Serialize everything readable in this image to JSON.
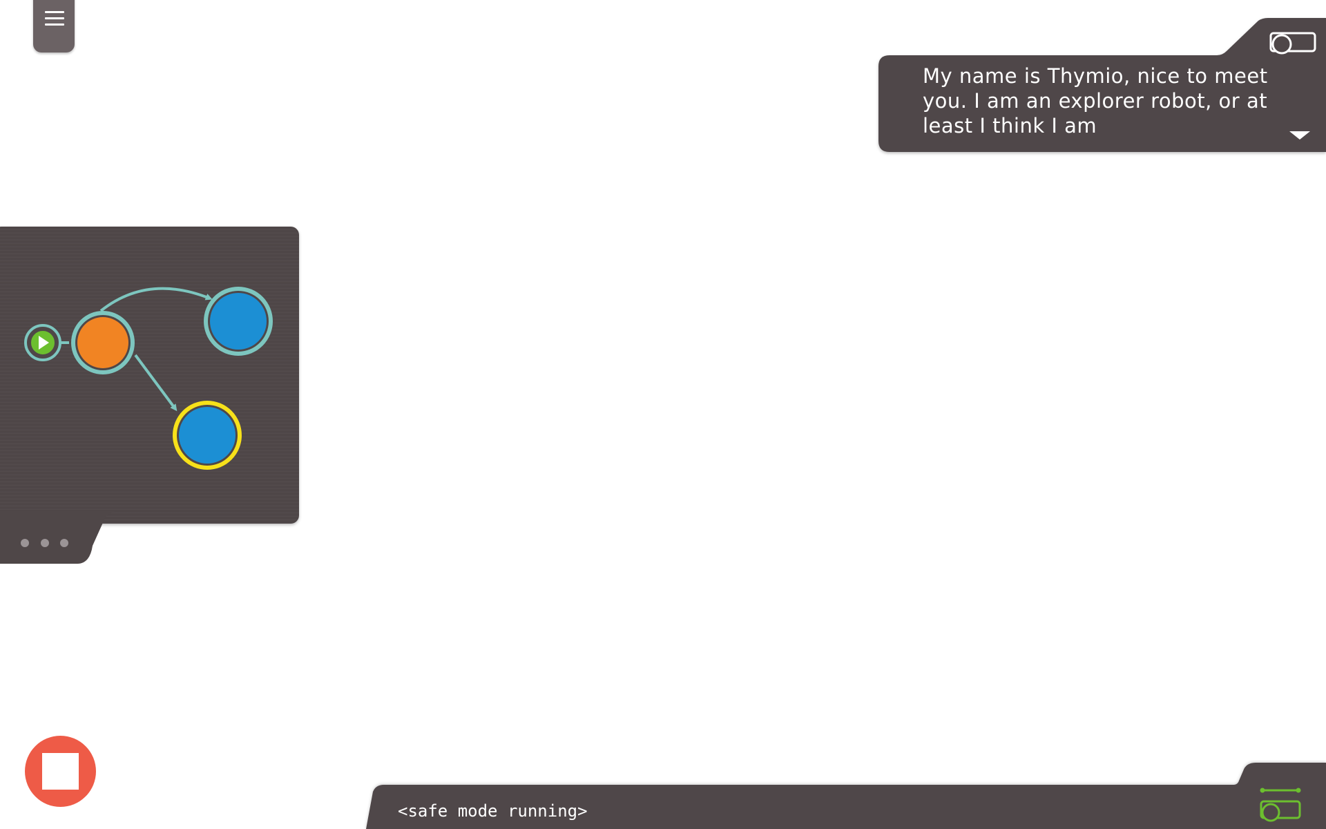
{
  "app": {
    "speech_text": "My name is Thymio, nice to meet you. I am an explorer robot, or at least I think I am",
    "status_text": "<safe mode running>"
  },
  "icons": {
    "menu": "hamburger-menu-icon",
    "camera": "camera-toggle-icon",
    "expand": "caret-down-icon",
    "stop": "stop-icon",
    "play": "play-icon",
    "more": "ellipsis-icon",
    "fullscreen": "camera-toggle-icon"
  },
  "program": {
    "states": [
      {
        "id": "start",
        "color": "#6cbf2f",
        "role": "start"
      },
      {
        "id": "state-orange",
        "color": "#f18423",
        "active": false
      },
      {
        "id": "state-blue-top",
        "color": "#1c8fd4",
        "active": false
      },
      {
        "id": "state-blue-bottom",
        "color": "#1c8fd4",
        "active": true
      }
    ]
  },
  "colors": {
    "panel": "#4f4748",
    "panel_light": "#6b6264",
    "accent_teal": "#7dc6bf",
    "highlight_yellow": "#f7e11a",
    "stop_red": "#ee5b47",
    "green": "#6cbf2f"
  }
}
